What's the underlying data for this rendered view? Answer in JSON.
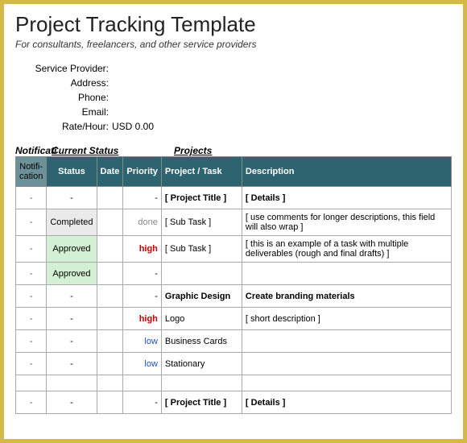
{
  "header": {
    "title": "Project Tracking Template",
    "subtitle": "For consultants, freelancers, and other service providers"
  },
  "info": {
    "service_provider_label": "Service Provider:",
    "service_provider_value": "",
    "address_label": "Address:",
    "address_value": "",
    "phone_label": "Phone:",
    "phone_value": "",
    "email_label": "Email:",
    "email_value": "",
    "rate_label": "Rate/Hour:",
    "rate_value": "USD 0.00"
  },
  "section_labels": {
    "notifications": "Notificati",
    "current_status": "Current Status",
    "projects": "Projects"
  },
  "columns": {
    "notif": "Notifi-cation",
    "status": "Status",
    "date": "Date",
    "priority": "Priority",
    "project": "Project / Task",
    "description": "Description"
  },
  "rows": [
    {
      "notif": "-",
      "status": "-",
      "status_class": "",
      "date": "",
      "priority": "-",
      "prio_class": "",
      "project": "[ Project Title ]",
      "desc": "[ Details ]",
      "bold": true
    },
    {
      "notif": "-",
      "status": "Completed",
      "status_class": "status-completed",
      "date": "",
      "priority": "done",
      "prio_class": "prio-done",
      "project": "[ Sub Task ]",
      "desc": "[ use comments for longer descriptions, this field will also wrap ]",
      "bold": false
    },
    {
      "notif": "-",
      "status": "Approved",
      "status_class": "status-approved",
      "date": "",
      "priority": "high",
      "prio_class": "prio-high",
      "project": "[ Sub Task ]",
      "desc": "[ this is an example of a task with multiple deliverables (rough and final drafts) ]",
      "bold": false
    },
    {
      "notif": "-",
      "status": "Approved",
      "status_class": "status-approved",
      "date": "",
      "priority": "-",
      "prio_class": "",
      "project": "",
      "desc": "",
      "bold": false
    },
    {
      "notif": "-",
      "status": "-",
      "status_class": "",
      "date": "",
      "priority": "-",
      "prio_class": "",
      "project": "Graphic Design",
      "desc": "Create branding materials",
      "bold": true
    },
    {
      "notif": "-",
      "status": "-",
      "status_class": "",
      "date": "",
      "priority": "high",
      "prio_class": "prio-high",
      "project": "Logo",
      "desc": "[ short description ]",
      "bold": false
    },
    {
      "notif": "-",
      "status": "-",
      "status_class": "",
      "date": "",
      "priority": "low",
      "prio_class": "prio-low",
      "project": "Business Cards",
      "desc": "",
      "bold": false
    },
    {
      "notif": "-",
      "status": "-",
      "status_class": "",
      "date": "",
      "priority": "low",
      "prio_class": "prio-low",
      "project": "Stationary",
      "desc": "",
      "bold": false
    },
    {
      "spacer": true
    },
    {
      "notif": "-",
      "status": "-",
      "status_class": "",
      "date": "",
      "priority": "-",
      "prio_class": "",
      "project": "[ Project Title ]",
      "desc": "[ Details ]",
      "bold": true
    }
  ]
}
